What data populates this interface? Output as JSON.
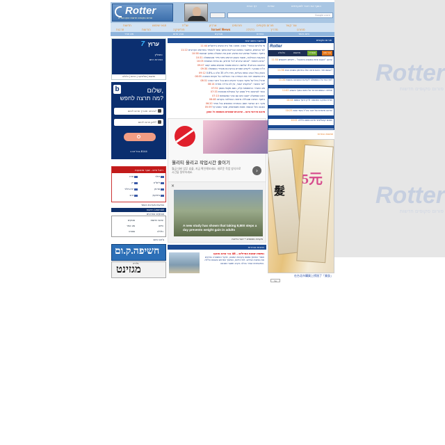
{
  "watermark": {
    "brand": "Rotter",
    "subtitle": "פורום סקופים חדשות",
    "color": "#c6cfe0"
  },
  "header": {
    "logo_text": "Rotter",
    "logo_tagline": "פורום סקופים חדשות ואקטואליה",
    "top_links": [
      "דף הבית",
      "אודות",
      "הוסף את רוטר למועדפים"
    ],
    "search_placeholder": "Google חיפוש",
    "search_icon": "search-icon",
    "background": "#a9c6e3"
  },
  "nav": {
    "items": [
      "צור קשר",
      "פורום סקופים",
      "פורומים",
      "ארכיון",
      "שו\"ת",
      "תנאי שימוש",
      "חדשות",
      "ספורט",
      "מדריך",
      "Israel News",
      "פוליטיקה",
      "הודעות",
      "כלכלה",
      "תרבות"
    ],
    "subnav": [
      "היום באתר",
      "כותרות",
      "מבזקים",
      "צבע אדום",
      "מזג אוויר"
    ],
    "accent": "#e48a2b"
  },
  "left": {
    "arutz7": {
      "brand": "ערוץ",
      "num": "7",
      "lines": [
        "ממליץ:",
        "כותרות היום"
      ],
      "bar": "חדשות | פוליטיקה | יהדות | כלכלה"
    },
    "bookit": {
      "hello": "שלום,",
      "ask": "מה תרצה לחפש?",
      "field1": "באיזה תאריך תרצו לטוס?",
      "field2": "לאן תרצו לטוס?",
      "footer": "בכל יום ב-B144",
      "logo": "b"
    },
    "rates": {
      "title": "ריאל טיים - שער מטבעות",
      "rows": [
        "דולר",
        "אירו",
        "ליש\"ט",
        "יין",
        "פרנק",
        "יורו-דולר",
        "ביטקוין",
        "זהב"
      ]
    },
    "lines": [
      "הודעות מערכת האתר",
      "חדשות LearnAll",
      "מבזקים אחרונים",
      "צ'אט היום",
      "כתבות ברשת"
    ],
    "box": [
      "עדכוני חדשות",
      "מבזקים",
      "ווידאו",
      "מזג אוויר",
      "כלכלה",
      "ספורט"
    ],
    "banner1": "חשיפה.ק.ום",
    "banner2": "מגזינט",
    "banner2_sub": "גלריה"
  },
  "middle": {
    "head1": "חדשות מתפרצות",
    "news": [
      {
        "t": "11:44",
        "s": "מי ש\"ביום הבוחר\" הפגין: מחאה מול בית הנשיא בירושלים"
      },
      {
        "t": "11:22",
        "s": "לפי הנתונים, המשבר בתחום הבריאות נמשך וצפוי להחמיר בחודשים הקרובים"
      },
      {
        "t": "10:58",
        "s": "נחשף: המחבל שביצע את הפיגוע תכנן את הפעולה במשך שבועות"
      },
      {
        "t": "10:31",
        "s": "בעקבות ההחלטה, תושבי הצפון דורשים פיצוי מיידי מהממשלה"
      },
      {
        "t": "10:05",
        "s": "גורם ביטחוני: \"אנחנו ערוכים לכל תרחיש, גם בחזית הצפונית\""
      },
      {
        "t": "09:47",
        "s": "התאונה בכביש 6: שלושה הרוגים ומספר פצועים במצב קשה"
      },
      {
        "t": "09:30",
        "s": "דו\"ח המבקר: ליקויים חמורים בהיערכות משרדי הממשלה"
      },
      {
        "t": "09:12",
        "s": "השוק בתל אביב נפתח בעליות, מדד ת\"א 35 עלה ב-0.8%"
      },
      {
        "t": "08:55",
        "s": "בית המשפט דחה את העתירה נגד ההחלטה על הקמת השכונה"
      },
      {
        "t": "08:31",
        "s": "תרגיל גדול של פיקוד העורף יתקיים היום בכל רחבי הארץ"
      },
      {
        "t": "08:14",
        "s": "שר האוצר: \"התקציב יעבור, אין לנו ברירה אחרת\""
      },
      {
        "t": "07:52",
        "s": "מזג האוויר: התחממות קלה, גשם מקומי בצפון"
      },
      {
        "t": "07:33",
        "s": "הותר לפרסום: חייל נפצע קל בפעילות מבצעית"
      },
      {
        "t": "07:10",
        "s": "ראש הממשלה ייפגש היום עם נציגי המשפחות"
      },
      {
        "t": "06:48",
        "s": "נחשף: הסיבה שבגללה נדחתה ההחלטה בקבינט"
      },
      {
        "t": "06:20",
        "s": "סקר: רוב הציבור תומך בהחזרת החטופים בכל מחיר"
      },
      {
        "t": "05:59",
        "s": "הפגנה מול הכנסת: מאות משתתפים, שוטר נפצע קל"
      }
    ],
    "headline": "סיכום אירועי היום – עדכונים שוטפים מהשטח כל הזמן",
    "ad": {
      "korean_title": "월리티 올리고 작업시간 줄이기",
      "korean_desc": "월급 대비 업무 효율, 지금 확인해보세요. 새로운 작업 방식으로 시간을 절약하세요.",
      "arrow": "›"
    },
    "ad2": {
      "close": "×",
      "caption": "A new study has shown that taking 8,800 steps a day prevents weight gain in adults",
      "source": "מקורות ממומנים • יועצי בריאות"
    },
    "head2": "כתבות נבחרות",
    "bottom": {
      "title": "נחשפו שמות החיילים – 48 בני אדם נפגעו",
      "text": "חומרי הפיצוץ נמצאו בקרבת המבנה, חוקרי המשטרה בודקים את נסיבות האירוע. לפי הדיווח, הפיצוץ התרחש בשעות הלילה המאוחרות ועורר בהלה בקרב תושבי השכונה."
    }
  },
  "right": {
    "head": "פורום סקופים",
    "logo": "Rotter",
    "tabs": [
      "הכי חם",
      "ספורט",
      "חדשות",
      "כלכלה"
    ],
    "items": [
      {
        "t": "11:50",
        "s": "עדכון: \"הצבא פתח במבצע ברצועה\" – דיווחים ראשונים"
      },
      {
        "t": "11:36",
        "s": "הגשם חזר: האם נראה שלג בחרמון בשבוע הבא?"
      },
      {
        "t": "11:20",
        "s": "לחץ כבד על הממשלה לקראת ההצבעה בכנסת"
      },
      {
        "t": "11:02",
        "s": "תחזית: הטמפרטורות יעלו מעט בסוף השבוע"
      },
      {
        "t": "10:44",
        "s": "ועדת החוקה התכנסה לדיון דחוף בנושא"
      },
      {
        "t": "10:25",
        "s": "הודעה מיוחדת של דובר צה\"ל בעוד שעה"
      },
      {
        "t": "10:11",
        "s": "הסכם קואליציוני חדש נחתם הלילה"
      }
    ],
    "label": "תמונות נבחרות",
    "product_big": "5元",
    "product_big2": "髮",
    "caption_jp": "在台北市購買上榜過了「美妝」",
    "more": "עוד"
  }
}
